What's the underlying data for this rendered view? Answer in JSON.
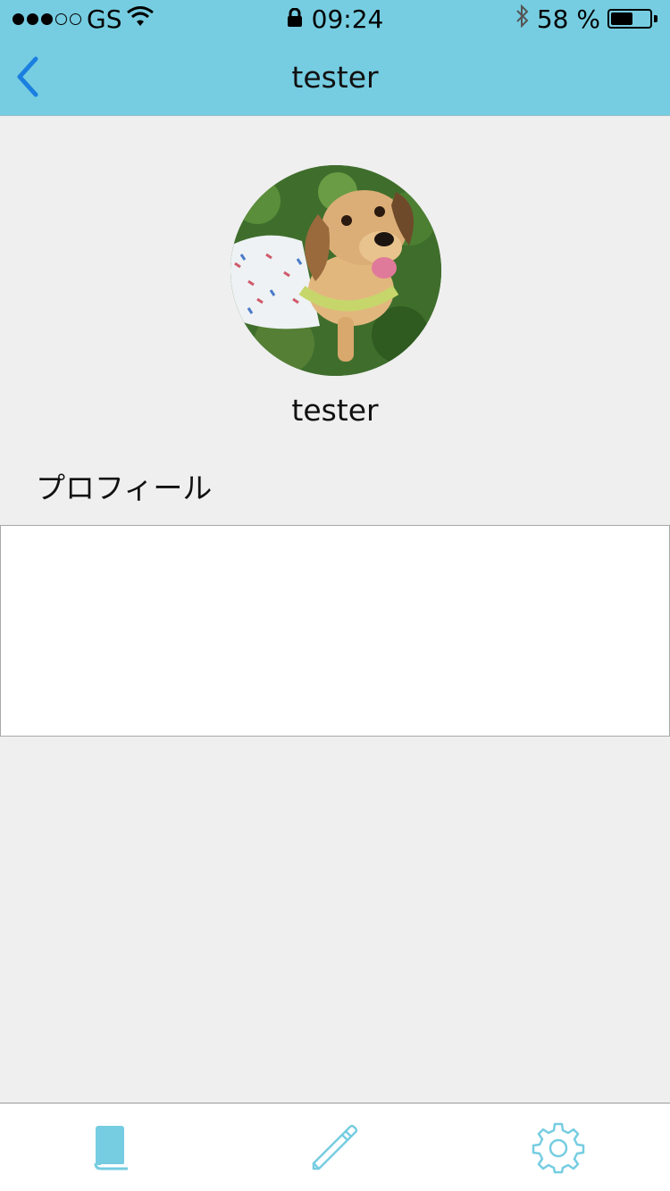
{
  "status_bar": {
    "carrier": "GS",
    "signal_bars_filled": 3,
    "signal_bars_total": 5,
    "time": "09:24",
    "battery_percent_text": "58 %",
    "battery_level": 0.58,
    "icons": [
      "wifi-icon",
      "lock-icon",
      "bluetooth-icon",
      "battery-icon"
    ]
  },
  "nav": {
    "title": "tester",
    "back_icon": "chevron-left-icon",
    "back_color": "#1a7fe0"
  },
  "profile": {
    "avatar_description": "dog-photo",
    "username": "tester",
    "section_label": "プロフィール",
    "bio_text": ""
  },
  "tab_bar": {
    "tabs": [
      {
        "icon": "book-icon",
        "active": true
      },
      {
        "icon": "pencil-icon",
        "active": false
      },
      {
        "icon": "gear-icon",
        "active": false
      }
    ],
    "icon_color": "#76cde1"
  },
  "colors": {
    "header_bg": "#76cde1",
    "page_bg": "#efefef"
  }
}
